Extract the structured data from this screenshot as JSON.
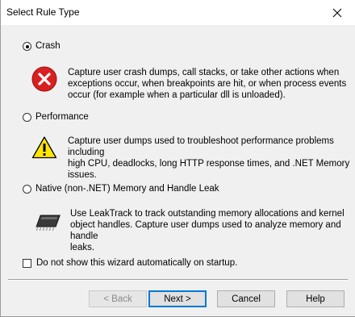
{
  "window": {
    "title": "Select Rule Type"
  },
  "options": [
    {
      "label": "Crash",
      "selected": true,
      "icon": "error-icon",
      "description": [
        "Capture user crash dumps, call stacks, or take other actions when",
        "exceptions occur, when breakpoints are hit, or when process events",
        "occur (for example when a particular dll is unloaded)."
      ]
    },
    {
      "label": "Performance",
      "selected": false,
      "icon": "warning-icon",
      "description": [
        "Capture user dumps used to troubleshoot performance problems including",
        "high CPU, deadlocks, long HTTP response times, and .NET Memory",
        "issues."
      ]
    },
    {
      "label": "Native (non-.NET) Memory and Handle Leak",
      "selected": false,
      "icon": "memory-chip-icon",
      "description": [
        "Use LeakTrack to track outstanding memory allocations and kernel",
        "object handles. Capture user dumps used to analyze memory and handle",
        "leaks."
      ]
    }
  ],
  "wizard_checkbox": {
    "label": "Do not show this wizard automatically on startup.",
    "checked": false
  },
  "buttons": {
    "back": "< Back",
    "next": "Next >",
    "cancel": "Cancel",
    "help": "Help"
  }
}
